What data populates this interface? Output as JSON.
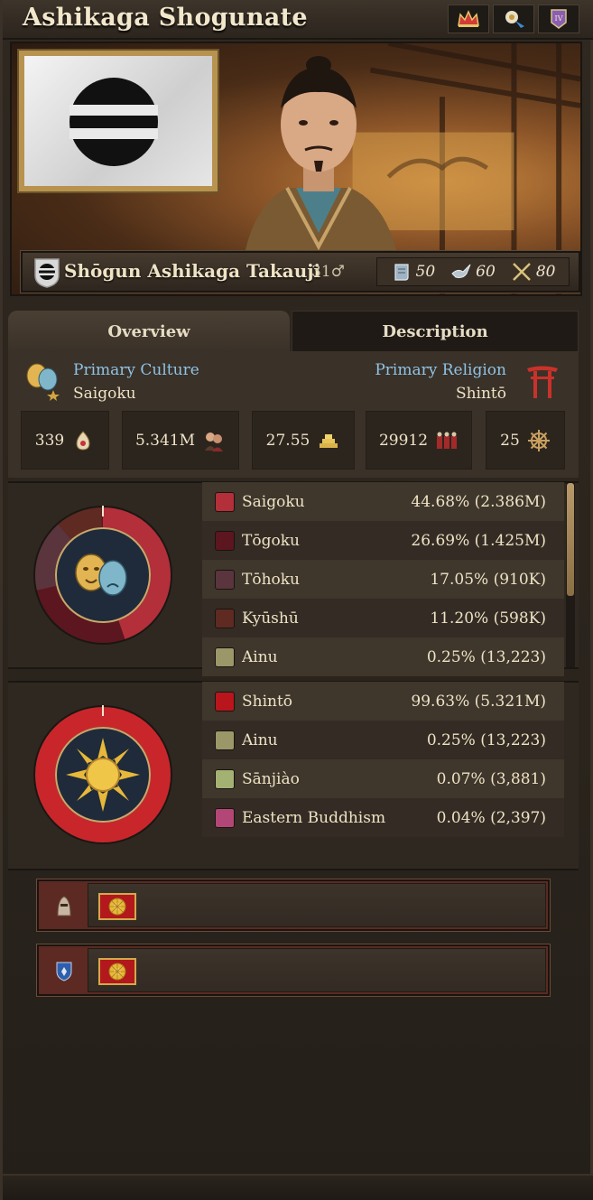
{
  "window": {
    "title": "Ashikaga Shogunate",
    "title_icons": [
      "crown-icon",
      "advisor-icon",
      "rank-badge-icon"
    ]
  },
  "character": {
    "name": "Shōgun Ashikaga Takauji",
    "age": "31",
    "gender_symbol": "♂",
    "skills": [
      {
        "icon": "administrative-scroll-icon",
        "value": "50"
      },
      {
        "icon": "diplomatic-dove-icon",
        "value": "60"
      },
      {
        "icon": "military-swords-icon",
        "value": "80"
      }
    ]
  },
  "tabs": [
    {
      "label": "Overview",
      "active": true
    },
    {
      "label": "Description",
      "active": false
    }
  ],
  "overview": {
    "primary_culture_label": "Primary Culture",
    "primary_culture_value": "Saigoku",
    "primary_religion_label": "Primary Religion",
    "primary_religion_value": "Shintō",
    "stats": [
      {
        "value": "339",
        "icon": "location-icon"
      },
      {
        "value": "5.341M",
        "icon": "population-icon"
      },
      {
        "value": "27.55",
        "icon": "gold-icon"
      },
      {
        "value": "29912",
        "icon": "army-icon"
      },
      {
        "value": "25",
        "icon": "navy-wheel-icon"
      }
    ]
  },
  "cultures": [
    {
      "name": "Saigoku",
      "pct": "44.68% (2.386M)",
      "color": "#b32f3a"
    },
    {
      "name": "Tōgoku",
      "pct": "26.69% (1.425M)",
      "color": "#5c1620"
    },
    {
      "name": "Tōhoku",
      "pct": "17.05% (910K)",
      "color": "#5a353d"
    },
    {
      "name": "Kyūshū",
      "pct": "11.20% (598K)",
      "color": "#5e2a22"
    },
    {
      "name": "Ainu",
      "pct": "0.25% (13,223)",
      "color": "#9b9768"
    }
  ],
  "religions": [
    {
      "name": "Shintō",
      "pct": "99.63% (5.321M)",
      "color": "#b8161c"
    },
    {
      "name": "Ainu",
      "pct": "0.25% (13,223)",
      "color": "#9b9768"
    },
    {
      "name": "Sānjiào",
      "pct": "0.07% (3,881)",
      "color": "#a3b173"
    },
    {
      "name": "Eastern Buddhism",
      "pct": "0.04% (2,397)",
      "color": "#b24777"
    }
  ],
  "colors": {
    "accent_blue": "#8fc3e6",
    "ring_red": "#c9262c"
  }
}
